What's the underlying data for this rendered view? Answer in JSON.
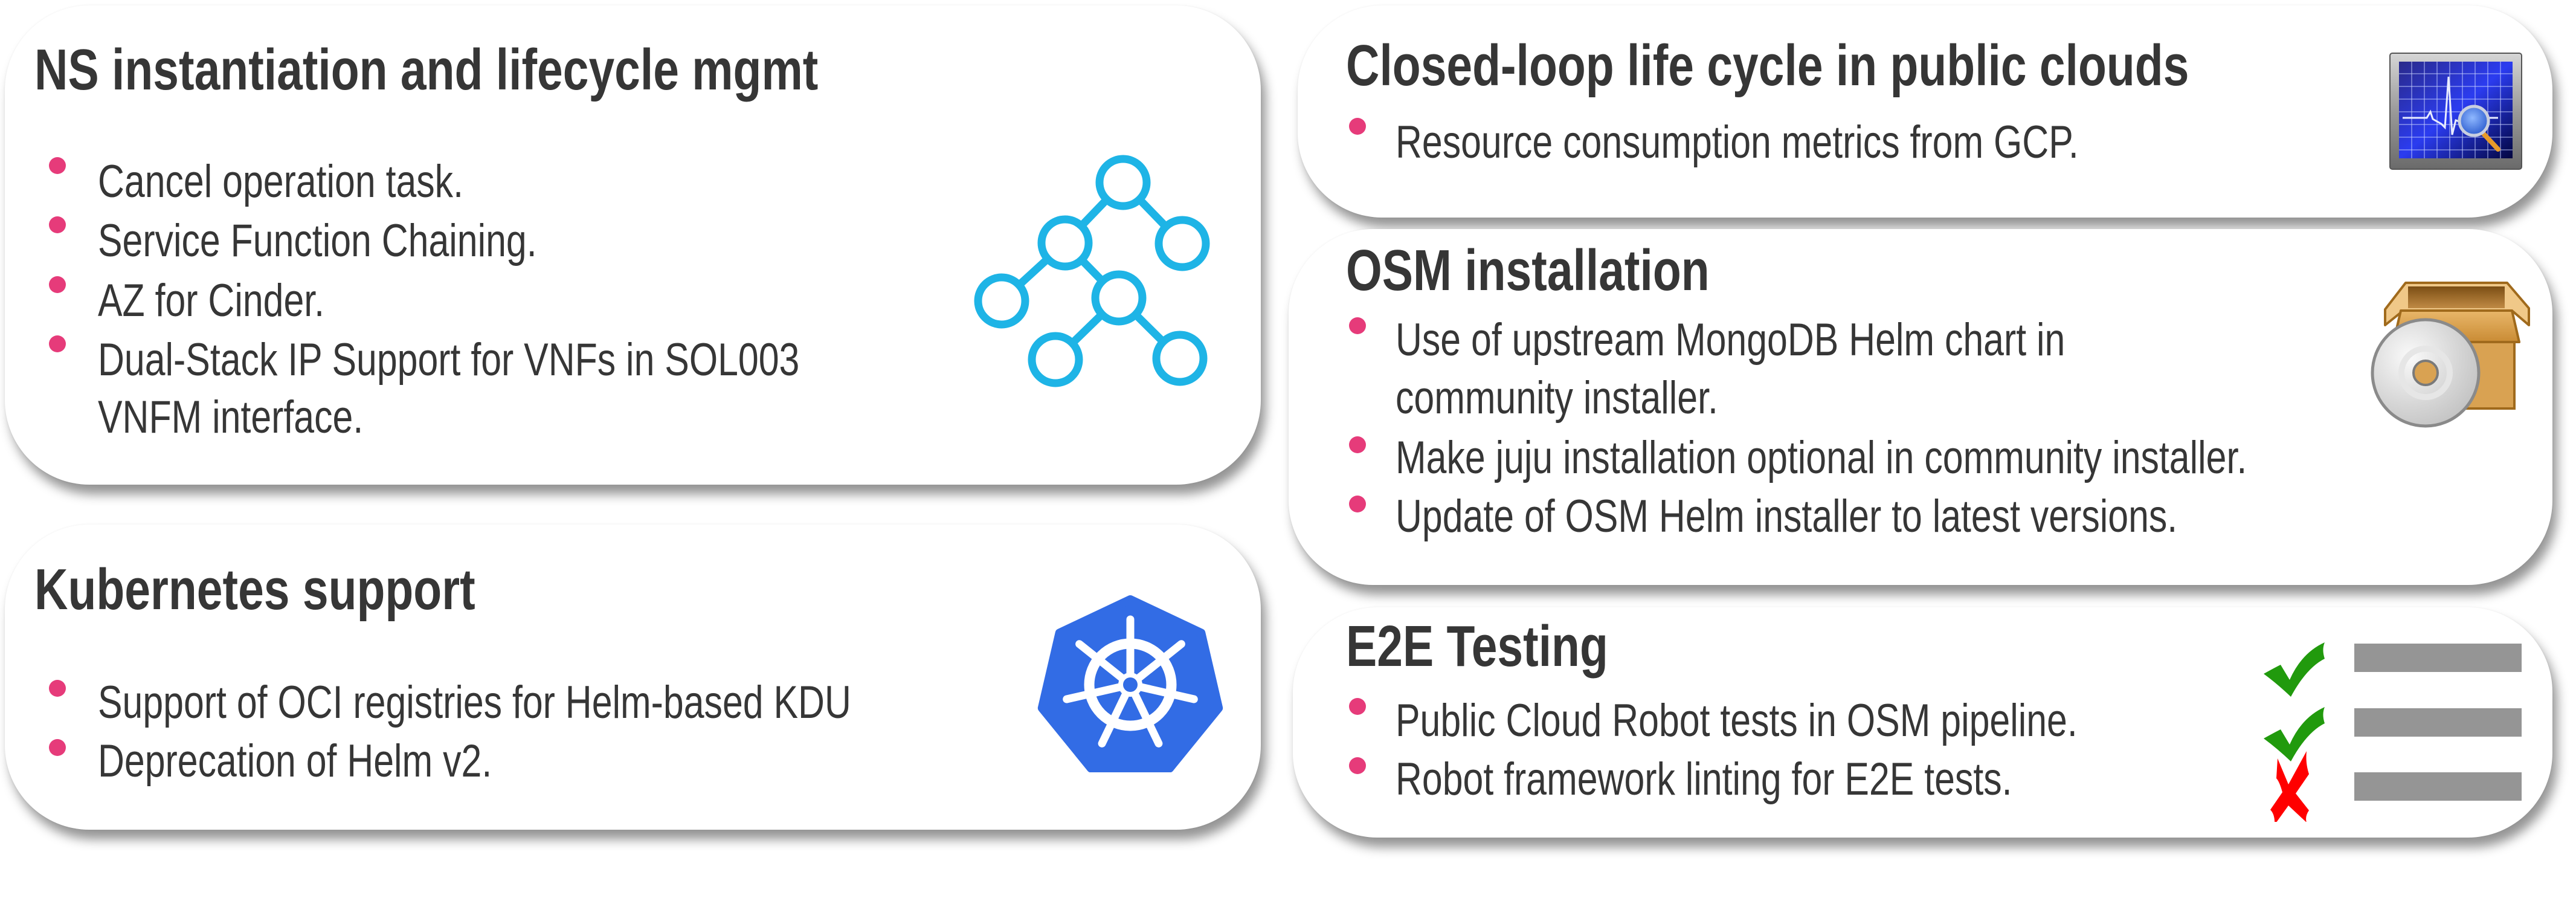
{
  "theme": {
    "text_color": "#363636",
    "bullet_color": "#e63b7a",
    "card_background": "#ffffff"
  },
  "cards": {
    "ns": {
      "title": "NS instantiation and lifecycle mgmt",
      "icon": "network-tree-icon",
      "icon_color": "#1eb4e6",
      "items": [
        {
          "lines": [
            "Cancel operation task."
          ]
        },
        {
          "lines": [
            "Service Function Chaining."
          ]
        },
        {
          "lines": [
            "AZ for Cinder."
          ]
        },
        {
          "lines": [
            "Dual-Stack IP Support for VNFs in SOL003",
            "VNFM interface."
          ]
        }
      ]
    },
    "closed_loop": {
      "title": "Closed-loop life cycle in public clouds",
      "icon": "monitor-graph-icon",
      "items": [
        {
          "lines": [
            "Resource consumption metrics from GCP."
          ]
        }
      ]
    },
    "kubernetes": {
      "title": "Kubernetes support",
      "icon": "kubernetes-logo-icon",
      "icon_color": "#326ce5",
      "items": [
        {
          "lines": [
            "Support of OCI registries for Helm-based KDU"
          ]
        },
        {
          "lines": [
            "Deprecation of Helm v2."
          ]
        }
      ]
    },
    "osm_install": {
      "title": "OSM installation",
      "icon": "package-box-cd-icon",
      "items": [
        {
          "lines": [
            "Use of upstream MongoDB Helm chart in",
            "community installer."
          ]
        },
        {
          "lines": [
            "Make juju installation optional in community installer."
          ]
        },
        {
          "lines": [
            "Update of OSM Helm installer to latest versions."
          ]
        }
      ]
    },
    "e2e": {
      "title": "E2E Testing",
      "icon": "checklist-icon",
      "checklist": [
        {
          "status": "pass",
          "color": "#219a0d"
        },
        {
          "status": "pass",
          "color": "#219a0d"
        },
        {
          "status": "fail",
          "color": "#ff0000"
        }
      ],
      "items": [
        {
          "lines": [
            "Public Cloud Robot tests in OSM pipeline."
          ]
        },
        {
          "lines": [
            "Robot framework linting for E2E tests."
          ]
        }
      ]
    }
  }
}
